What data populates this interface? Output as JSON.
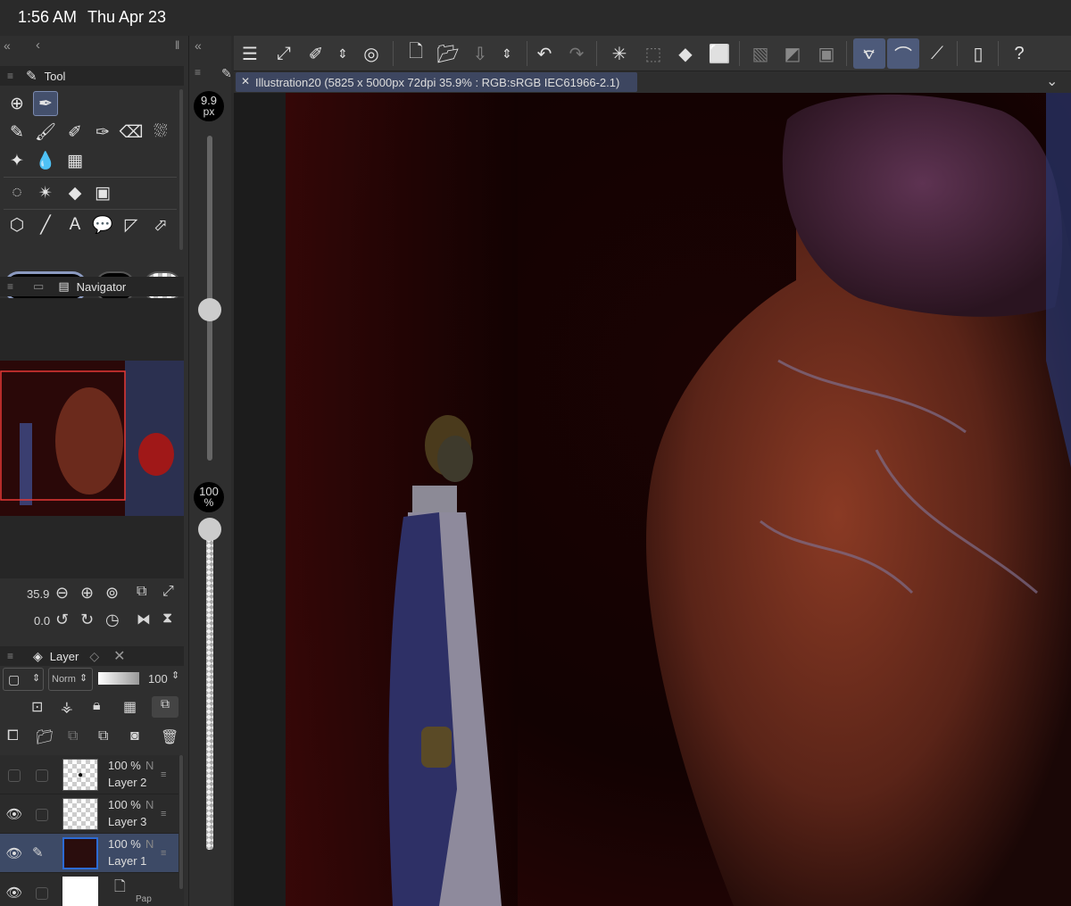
{
  "status": {
    "time": "1:56 AM",
    "date": "Thu Apr 23"
  },
  "tool_panel": {
    "title": "Tool",
    "brush_size": "9.9",
    "brush_unit": "px",
    "opacity_value": "100",
    "opacity_unit": "%"
  },
  "navigator": {
    "title": "Navigator",
    "zoom": "35.9",
    "rotation": "0.0"
  },
  "layer_panel": {
    "title": "Layer",
    "blend_mode": "Norm",
    "opacity": "100",
    "layers": [
      {
        "pct": "100 %",
        "mode": "N",
        "name": "Layer 2",
        "visible": false
      },
      {
        "pct": "100 %",
        "mode": "N",
        "name": "Layer 3",
        "visible": true
      },
      {
        "pct": "100 %",
        "mode": "N",
        "name": "Layer 1",
        "visible": true,
        "selected": true
      },
      {
        "pct": "",
        "mode": "",
        "name": "Pap",
        "visible": true
      }
    ]
  },
  "document": {
    "tab_title": "Illustration20 (5825 x 5000px 72dpi 35.9% : RGB:sRGB IEC61966-2.1)"
  },
  "colors": {
    "accent": "#4d5a7a",
    "navigator_frame": "#e53935"
  }
}
